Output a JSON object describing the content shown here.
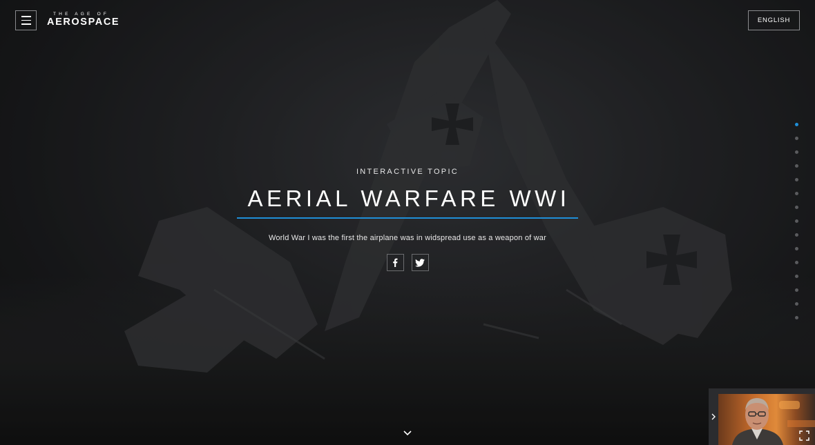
{
  "header": {
    "logo_small": "THE AGE OF",
    "logo_big": "AEROSPACE",
    "menu_icon": "hamburger-menu-icon",
    "language_label": "ENGLISH"
  },
  "hero": {
    "kicker": "INTERACTIVE TOPIC",
    "title": "AERIAL WARFARE WWI",
    "description": "World War I was the first the airplane was in widspread use as a weapon of war",
    "share": [
      {
        "icon": "facebook-icon"
      },
      {
        "icon": "twitter-icon"
      }
    ]
  },
  "section_nav": {
    "count": 15,
    "active_index": 0
  },
  "video": {
    "toggle_icon": "chevron-right-icon",
    "fullscreen_icon": "fullscreen-icon"
  },
  "colors": {
    "accent": "#1f8fd8",
    "background": "#1b1c1e",
    "border": "#8a8b8e"
  }
}
